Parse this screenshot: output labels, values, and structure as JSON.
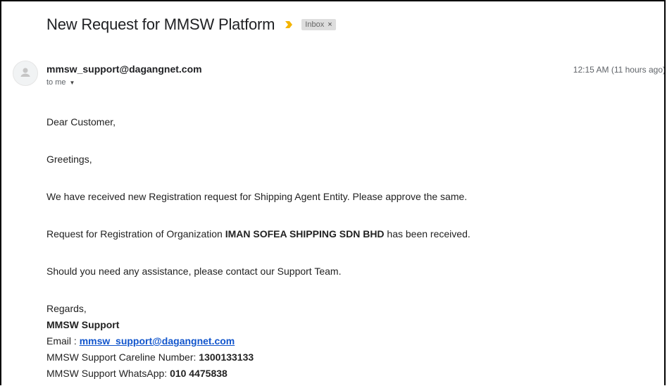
{
  "email": {
    "subject": "New Request for MMSW Platform",
    "label": "Inbox",
    "label_remove": "×",
    "sender": "mmsw_support@dagangnet.com",
    "recipient": "to me",
    "timestamp": "12:15 AM (11 hours ago)",
    "body": {
      "greeting": "Dear Customer,",
      "greetings2": "Greetings,",
      "line1": "We have received new Registration request for Shipping Agent Entity. Please approve the same.",
      "line2_prefix": "Request for Registration of Organization ",
      "line2_org": "IMAN SOFEA SHIPPING SDN BHD",
      "line2_suffix": " has been received.",
      "line3": "Should you need any assistance, please contact our Support Team.",
      "regards": "Regards,",
      "signature_name": "MMSW Support",
      "email_label": "Email : ",
      "email_link": "mmsw_support@dagangnet.com",
      "careline_label": "MMSW Support Careline Number: ",
      "careline_number": "1300133133",
      "whatsapp_label": "MMSW Support WhatsApp: ",
      "whatsapp_number": "010 4475838"
    }
  },
  "colors": {
    "importance_marker": "#f4b400",
    "link": "#1155cc",
    "label_chip_bg": "#dddddd"
  },
  "icons": [
    "importance-marker-icon",
    "avatar-person-icon",
    "caret-down-icon",
    "close-icon"
  ]
}
